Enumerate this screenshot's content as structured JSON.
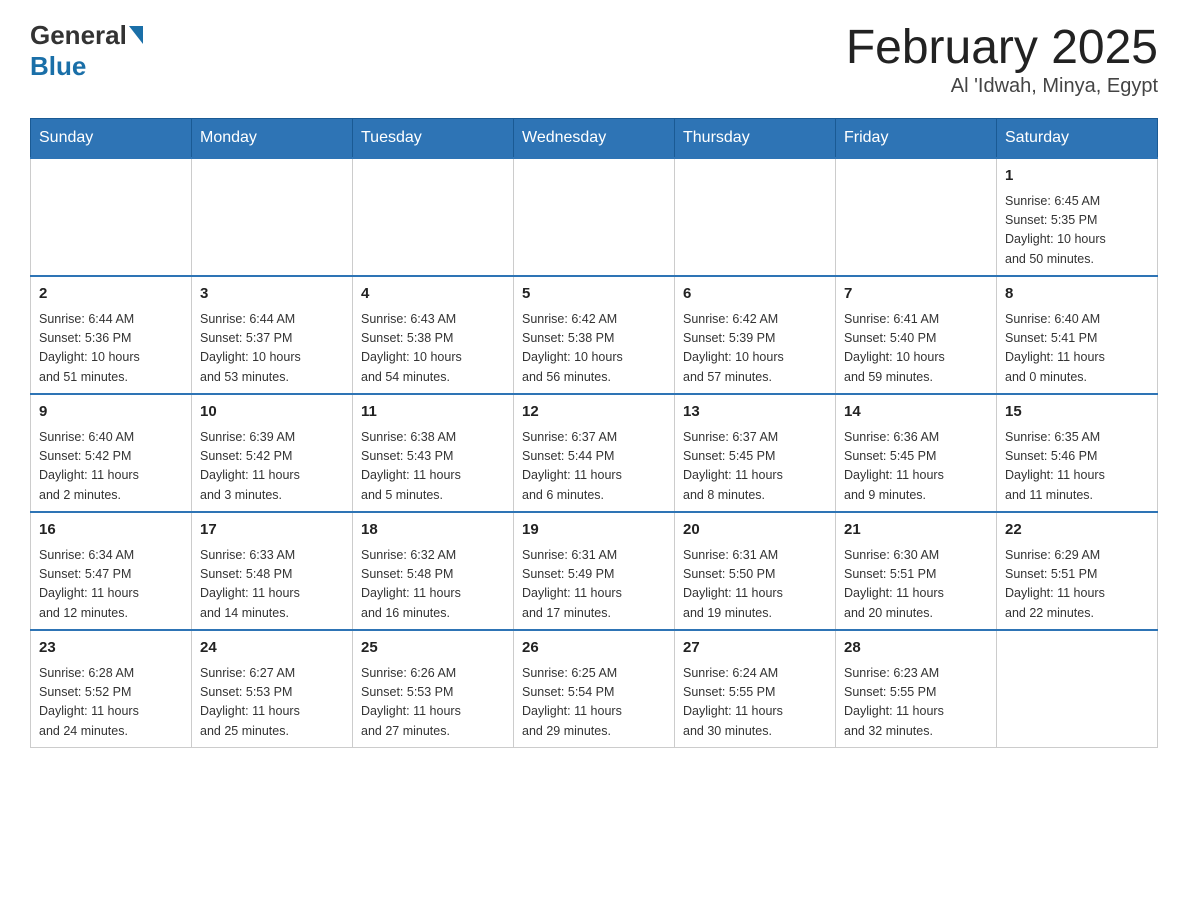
{
  "header": {
    "logo_general": "General",
    "logo_blue": "Blue",
    "title": "February 2025",
    "subtitle": "Al 'Idwah, Minya, Egypt"
  },
  "days_of_week": [
    "Sunday",
    "Monday",
    "Tuesday",
    "Wednesday",
    "Thursday",
    "Friday",
    "Saturday"
  ],
  "weeks": [
    {
      "days": [
        {
          "num": "",
          "info": ""
        },
        {
          "num": "",
          "info": ""
        },
        {
          "num": "",
          "info": ""
        },
        {
          "num": "",
          "info": ""
        },
        {
          "num": "",
          "info": ""
        },
        {
          "num": "",
          "info": ""
        },
        {
          "num": "1",
          "info": "Sunrise: 6:45 AM\nSunset: 5:35 PM\nDaylight: 10 hours\nand 50 minutes."
        }
      ]
    },
    {
      "days": [
        {
          "num": "2",
          "info": "Sunrise: 6:44 AM\nSunset: 5:36 PM\nDaylight: 10 hours\nand 51 minutes."
        },
        {
          "num": "3",
          "info": "Sunrise: 6:44 AM\nSunset: 5:37 PM\nDaylight: 10 hours\nand 53 minutes."
        },
        {
          "num": "4",
          "info": "Sunrise: 6:43 AM\nSunset: 5:38 PM\nDaylight: 10 hours\nand 54 minutes."
        },
        {
          "num": "5",
          "info": "Sunrise: 6:42 AM\nSunset: 5:38 PM\nDaylight: 10 hours\nand 56 minutes."
        },
        {
          "num": "6",
          "info": "Sunrise: 6:42 AM\nSunset: 5:39 PM\nDaylight: 10 hours\nand 57 minutes."
        },
        {
          "num": "7",
          "info": "Sunrise: 6:41 AM\nSunset: 5:40 PM\nDaylight: 10 hours\nand 59 minutes."
        },
        {
          "num": "8",
          "info": "Sunrise: 6:40 AM\nSunset: 5:41 PM\nDaylight: 11 hours\nand 0 minutes."
        }
      ]
    },
    {
      "days": [
        {
          "num": "9",
          "info": "Sunrise: 6:40 AM\nSunset: 5:42 PM\nDaylight: 11 hours\nand 2 minutes."
        },
        {
          "num": "10",
          "info": "Sunrise: 6:39 AM\nSunset: 5:42 PM\nDaylight: 11 hours\nand 3 minutes."
        },
        {
          "num": "11",
          "info": "Sunrise: 6:38 AM\nSunset: 5:43 PM\nDaylight: 11 hours\nand 5 minutes."
        },
        {
          "num": "12",
          "info": "Sunrise: 6:37 AM\nSunset: 5:44 PM\nDaylight: 11 hours\nand 6 minutes."
        },
        {
          "num": "13",
          "info": "Sunrise: 6:37 AM\nSunset: 5:45 PM\nDaylight: 11 hours\nand 8 minutes."
        },
        {
          "num": "14",
          "info": "Sunrise: 6:36 AM\nSunset: 5:45 PM\nDaylight: 11 hours\nand 9 minutes."
        },
        {
          "num": "15",
          "info": "Sunrise: 6:35 AM\nSunset: 5:46 PM\nDaylight: 11 hours\nand 11 minutes."
        }
      ]
    },
    {
      "days": [
        {
          "num": "16",
          "info": "Sunrise: 6:34 AM\nSunset: 5:47 PM\nDaylight: 11 hours\nand 12 minutes."
        },
        {
          "num": "17",
          "info": "Sunrise: 6:33 AM\nSunset: 5:48 PM\nDaylight: 11 hours\nand 14 minutes."
        },
        {
          "num": "18",
          "info": "Sunrise: 6:32 AM\nSunset: 5:48 PM\nDaylight: 11 hours\nand 16 minutes."
        },
        {
          "num": "19",
          "info": "Sunrise: 6:31 AM\nSunset: 5:49 PM\nDaylight: 11 hours\nand 17 minutes."
        },
        {
          "num": "20",
          "info": "Sunrise: 6:31 AM\nSunset: 5:50 PM\nDaylight: 11 hours\nand 19 minutes."
        },
        {
          "num": "21",
          "info": "Sunrise: 6:30 AM\nSunset: 5:51 PM\nDaylight: 11 hours\nand 20 minutes."
        },
        {
          "num": "22",
          "info": "Sunrise: 6:29 AM\nSunset: 5:51 PM\nDaylight: 11 hours\nand 22 minutes."
        }
      ]
    },
    {
      "days": [
        {
          "num": "23",
          "info": "Sunrise: 6:28 AM\nSunset: 5:52 PM\nDaylight: 11 hours\nand 24 minutes."
        },
        {
          "num": "24",
          "info": "Sunrise: 6:27 AM\nSunset: 5:53 PM\nDaylight: 11 hours\nand 25 minutes."
        },
        {
          "num": "25",
          "info": "Sunrise: 6:26 AM\nSunset: 5:53 PM\nDaylight: 11 hours\nand 27 minutes."
        },
        {
          "num": "26",
          "info": "Sunrise: 6:25 AM\nSunset: 5:54 PM\nDaylight: 11 hours\nand 29 minutes."
        },
        {
          "num": "27",
          "info": "Sunrise: 6:24 AM\nSunset: 5:55 PM\nDaylight: 11 hours\nand 30 minutes."
        },
        {
          "num": "28",
          "info": "Sunrise: 6:23 AM\nSunset: 5:55 PM\nDaylight: 11 hours\nand 32 minutes."
        },
        {
          "num": "",
          "info": ""
        }
      ]
    }
  ]
}
